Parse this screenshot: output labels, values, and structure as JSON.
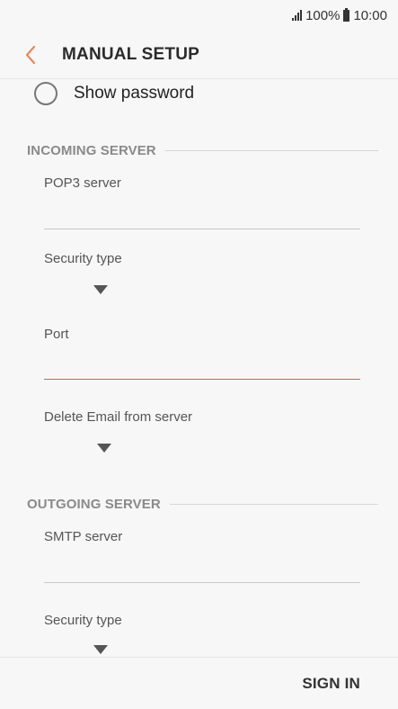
{
  "status_bar": {
    "battery_percent": "100%",
    "time": "10:00"
  },
  "header": {
    "title": "MANUAL SETUP"
  },
  "show_password": {
    "label": "Show password",
    "checked": false
  },
  "incoming_server": {
    "title": "INCOMING SERVER",
    "pop3_server_label": "POP3 server",
    "pop3_server_value": "",
    "security_type_label": "Security type",
    "security_type_value": "",
    "port_label": "Port",
    "port_value": "",
    "delete_email_label": "Delete Email from server",
    "delete_email_value": ""
  },
  "outgoing_server": {
    "title": "OUTGOING SERVER",
    "smtp_server_label": "SMTP server",
    "smtp_server_value": "",
    "security_type_label": "Security type",
    "security_type_value": ""
  },
  "footer": {
    "sign_in_label": "SIGN IN"
  },
  "colors": {
    "accent": "#e0603b",
    "background": "#f7f7f7"
  }
}
